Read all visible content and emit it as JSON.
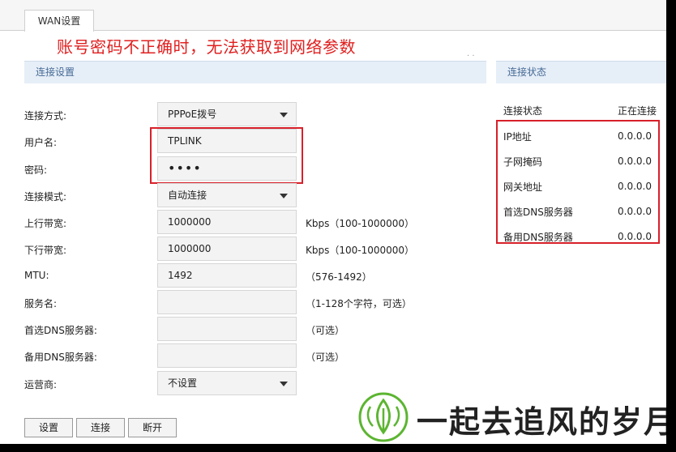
{
  "tab": {
    "label": "WAN设置"
  },
  "warning": "账号密码不正确时，无法获取到网络参数",
  "sections": {
    "left": "连接设置",
    "right": "连接状态"
  },
  "form": {
    "connection_type": {
      "label": "连接方式:",
      "value": "PPPoE拨号"
    },
    "username": {
      "label": "用户名:",
      "value": "TPLINK"
    },
    "password": {
      "label": "密码:",
      "value": "••••"
    },
    "connection_mode": {
      "label": "连接模式:",
      "value": "自动连接"
    },
    "upstream": {
      "label": "上行带宽:",
      "value": "1000000",
      "hint": "Kbps（100-1000000）"
    },
    "downstream": {
      "label": "下行带宽:",
      "value": "1000000",
      "hint": "Kbps（100-1000000）"
    },
    "mtu": {
      "label": "MTU:",
      "value": "1492",
      "hint": "（576-1492）"
    },
    "service_name": {
      "label": "服务名:",
      "value": "",
      "hint": "（1-128个字符，可选）"
    },
    "primary_dns": {
      "label": "首选DNS服务器:",
      "value": "",
      "hint": "（可选）"
    },
    "secondary_dns": {
      "label": "备用DNS服务器:",
      "value": "",
      "hint": "（可选）"
    },
    "isp": {
      "label": "运营商:",
      "value": "不设置"
    }
  },
  "status": {
    "header_label": "连接状态",
    "header_value": "正在连接",
    "rows": [
      {
        "label": "IP地址",
        "value": "0.0.0.0"
      },
      {
        "label": "子网掩码",
        "value": "0.0.0.0"
      },
      {
        "label": "网关地址",
        "value": "0.0.0.0"
      },
      {
        "label": "首选DNS服务器",
        "value": "0.0.0.0"
      },
      {
        "label": "备用DNS服务器",
        "value": "0.0.0.0"
      }
    ]
  },
  "buttons": {
    "save": "设置",
    "connect": "连接",
    "disconnect": "断开"
  },
  "watermark": {
    "text": "一起去追风的岁月",
    "logo": "leaf-logo-icon"
  },
  "colors": {
    "accent_red": "#d8202a",
    "header_bg": "#e6eef7",
    "header_text": "#466a96",
    "logo_green": "#5cb531"
  }
}
